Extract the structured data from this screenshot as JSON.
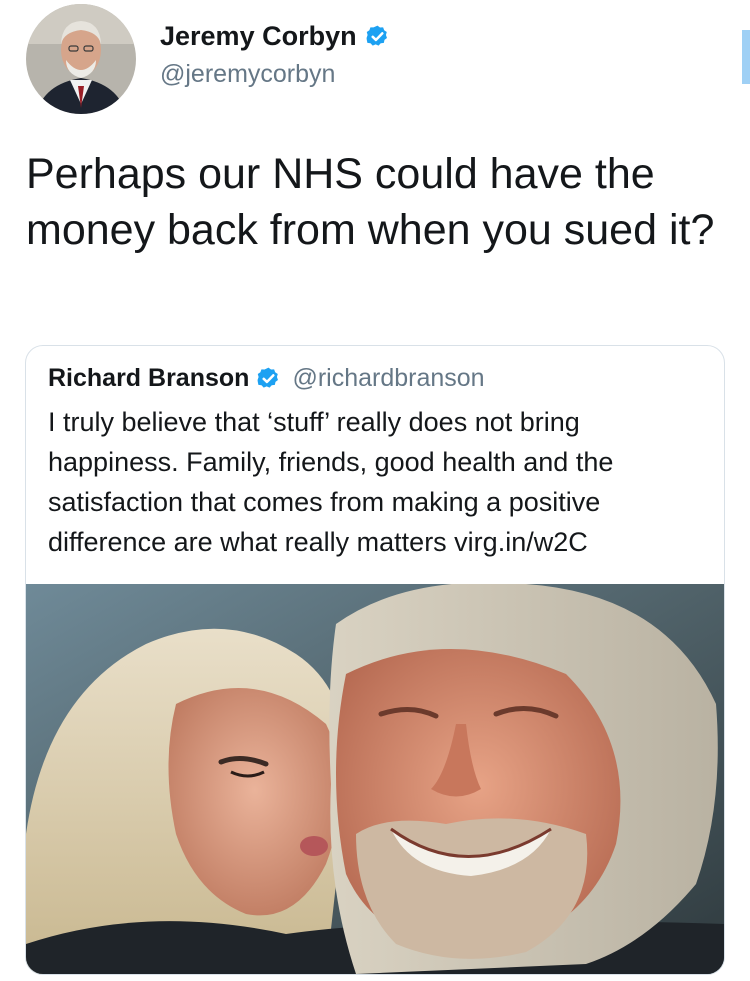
{
  "tweet": {
    "author_name": "Jeremy Corbyn",
    "author_handle": "@jeremycorbyn",
    "verified_icon": "verified-badge-icon",
    "text": "Perhaps our NHS could have the money back from when you sued it?"
  },
  "quoted_tweet": {
    "author_name": "Richard Branson",
    "author_handle": "@richardbranson",
    "verified_icon": "verified-badge-icon",
    "text": "I truly believe that ‘stuff’ really does not bring happiness. Family, friends, good health and the satisfaction that comes from making a positive difference are what really matters virg.in/w2C",
    "media": "photo-of-couple-smiling"
  },
  "colors": {
    "primary_text": "#14171a",
    "secondary_text": "#657786",
    "verified_blue": "#1da1f2",
    "card_border": "#d9e1e8"
  }
}
